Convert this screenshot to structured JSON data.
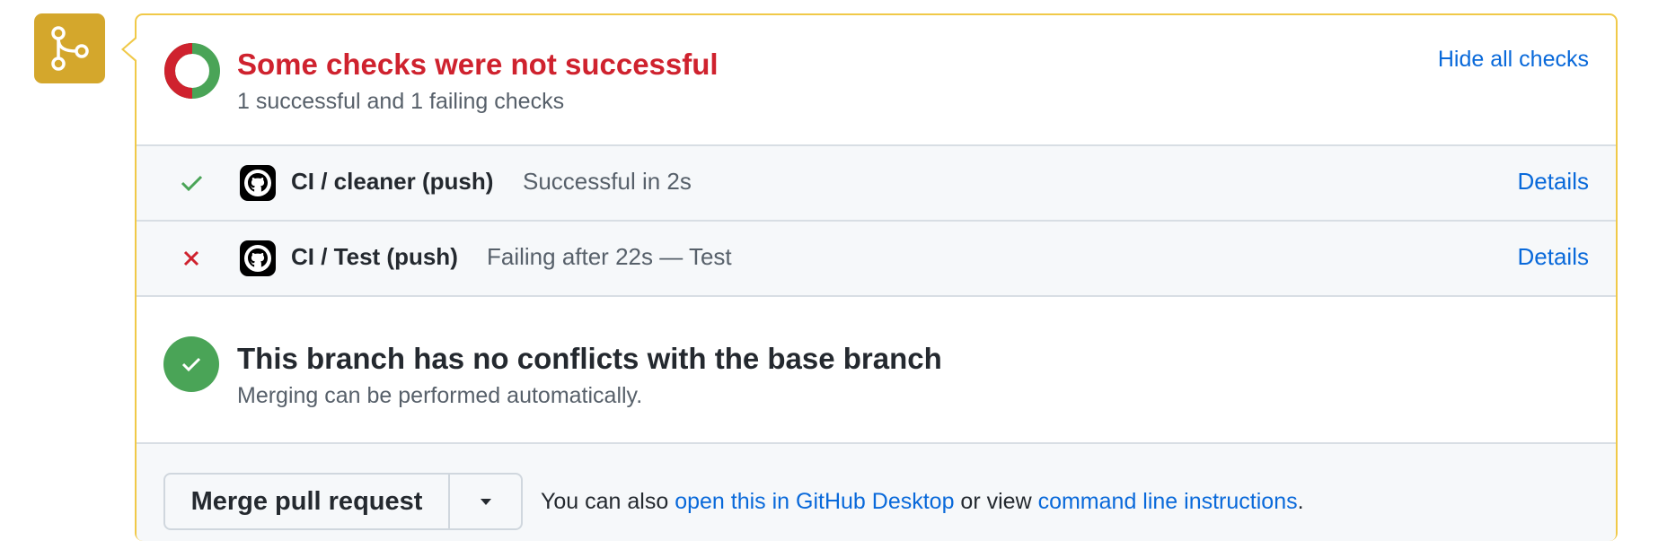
{
  "merge_box": {
    "status": {
      "title": "Some checks were not successful",
      "subtitle": "1 successful and 1 failing checks",
      "hide_checks_label": "Hide all checks",
      "successful_count": 1,
      "failing_count": 1
    },
    "checks": [
      {
        "status": "success",
        "name": "CI / cleaner (push)",
        "description": "Successful in 2s",
        "details_label": "Details"
      },
      {
        "status": "failure",
        "name": "CI / Test (push)",
        "description": "Failing after 22s — Test",
        "details_label": "Details"
      }
    ],
    "conflicts": {
      "title": "This branch has no conflicts with the base branch",
      "subtitle": "Merging can be performed automatically."
    },
    "merge": {
      "button_label": "Merge pull request",
      "also_prefix": "You can also ",
      "desktop_link": "open this in GitHub Desktop",
      "middle_text": " or view ",
      "cli_link": "command line instructions",
      "suffix": "."
    }
  },
  "colors": {
    "merge_icon_bg": "#d4a72c",
    "panel_border": "#f0c948",
    "failure": "#cf222e",
    "success": "#4aa457",
    "link": "#0969da"
  },
  "icons": {
    "merge_state": "git-merge-icon",
    "status_donut": "check-status-donut-icon",
    "check_success": "check-icon",
    "check_failure": "x-icon",
    "app": "github-icon",
    "conflicts_ok": "check-circle-icon",
    "dropdown": "triangle-down-icon"
  }
}
